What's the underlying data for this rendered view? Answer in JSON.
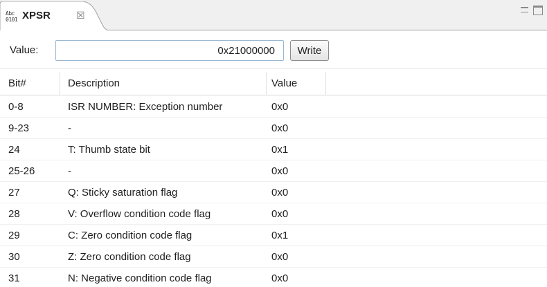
{
  "view": {
    "tab_icon_text": "Abc 0101",
    "tab_title": "XPSR",
    "tab_close_glyph": "☒",
    "tab_icon_name": "register-icon",
    "controls": [
      "minimize-icon",
      "maximize-icon"
    ]
  },
  "value_row": {
    "label": "Value:",
    "input_value": "0x21000000",
    "write_label": "Write"
  },
  "table": {
    "columns": [
      "Bit#",
      "Description",
      "Value"
    ],
    "rows": [
      {
        "bit": "0-8",
        "description": "ISR NUMBER: Exception number",
        "value": "0x0"
      },
      {
        "bit": "9-23",
        "description": "-",
        "value": "0x0"
      },
      {
        "bit": "24",
        "description": "T: Thumb state bit",
        "value": "0x1"
      },
      {
        "bit": "25-26",
        "description": "-",
        "value": "0x0"
      },
      {
        "bit": "27",
        "description": "Q: Sticky saturation flag",
        "value": "0x0"
      },
      {
        "bit": "28",
        "description": "V: Overflow condition code flag",
        "value": "0x0"
      },
      {
        "bit": "29",
        "description": "C: Zero condition code flag",
        "value": "0x1"
      },
      {
        "bit": "30",
        "description": "Z: Zero condition code flag",
        "value": "0x0"
      },
      {
        "bit": "31",
        "description": "N: Negative condition code flag",
        "value": "0x0"
      }
    ]
  },
  "colors": {
    "tab_background": "#f0f0f0",
    "input_border": "#9ab7d4",
    "grid_line": "#e0e0e0"
  }
}
